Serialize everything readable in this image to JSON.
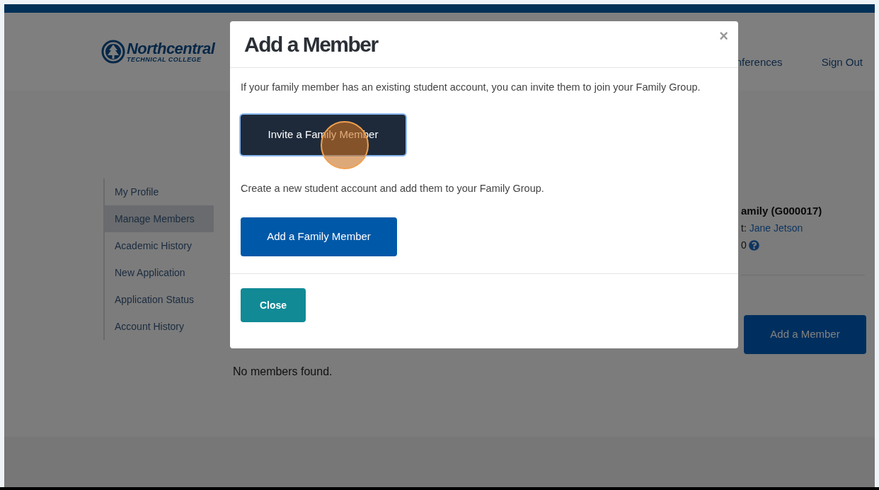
{
  "header": {
    "logo": {
      "name": "Northcentral",
      "subtitle": "TECHNICAL COLLEGE"
    },
    "nav": [
      "nferences",
      "Sign Out"
    ]
  },
  "sidebar": {
    "items": [
      {
        "label": "My Profile",
        "selected": false
      },
      {
        "label": "Manage Members",
        "selected": true
      },
      {
        "label": "Academic History",
        "selected": false
      },
      {
        "label": "New Application",
        "selected": false
      },
      {
        "label": "Application Status",
        "selected": false
      },
      {
        "label": "Account History",
        "selected": false
      }
    ]
  },
  "family": {
    "name": "amily (G000017)",
    "contact_label": "t:",
    "contact_name": "Jane Jetson",
    "count": "0"
  },
  "add_member_button": "Add a Member",
  "empty_message": "No members found.",
  "dialog": {
    "title": "Add a Member",
    "close": "×",
    "invite_text": "If your family member has an existing student account, you can invite them to join your Family Group.",
    "invite_button": {
      "label": "Invite a Family Member",
      "focused": true
    },
    "create_text": "Create a new student account and add them to your Family Group.",
    "add_button": "Add a Family Member",
    "footer_button": "Close"
  }
}
